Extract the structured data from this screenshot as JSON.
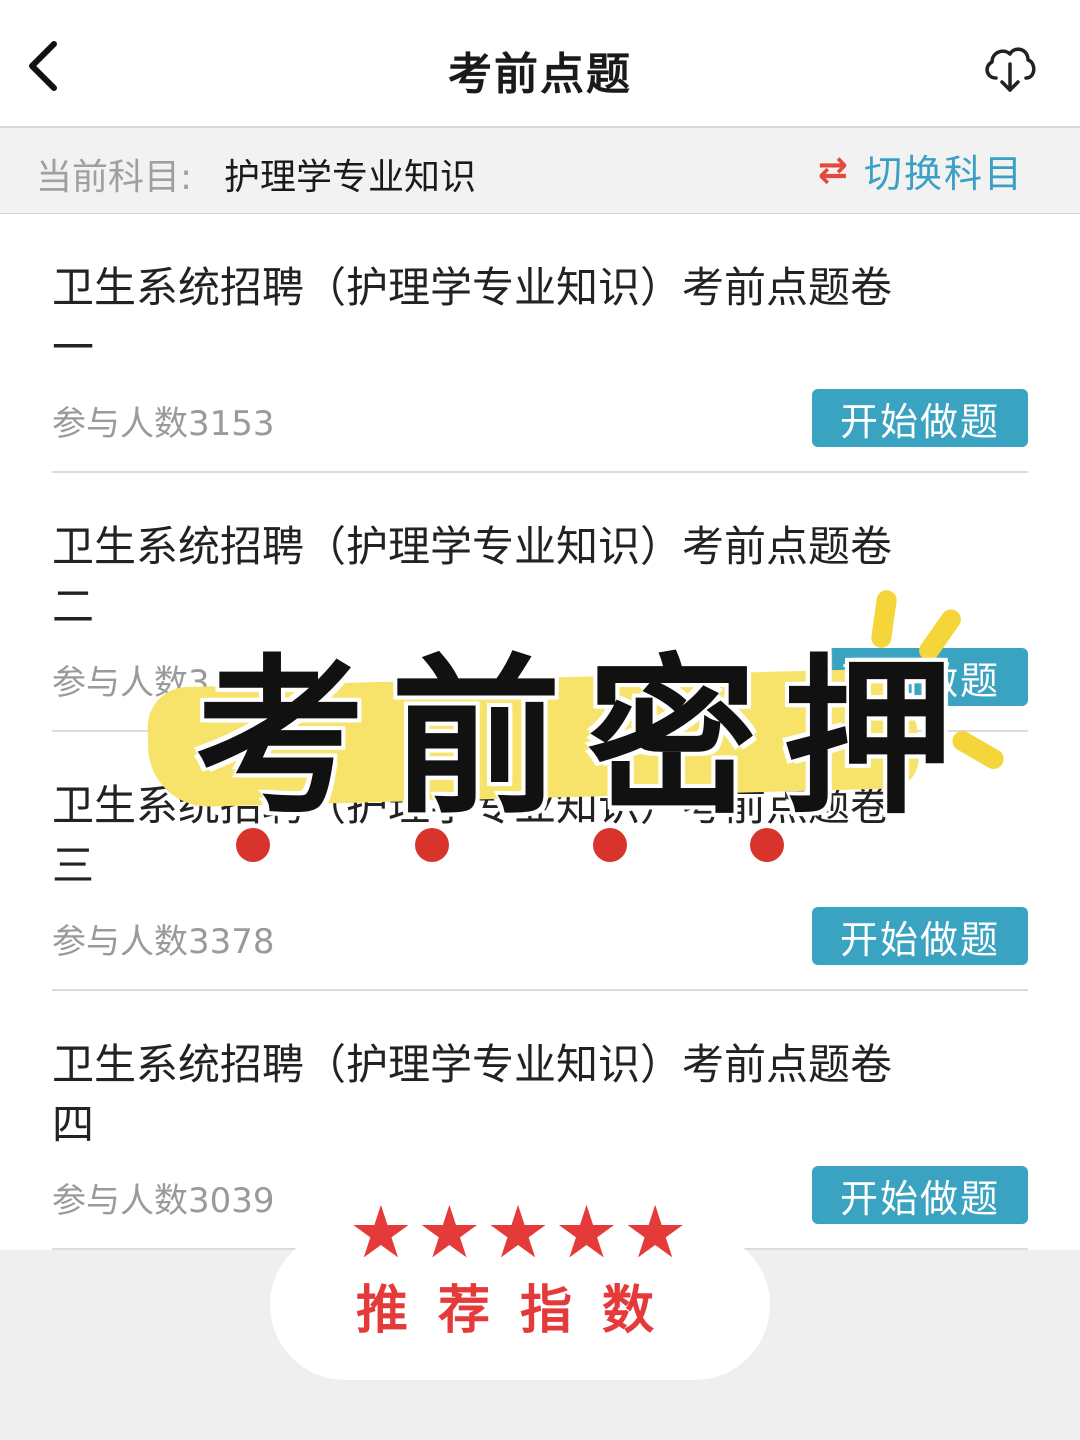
{
  "header": {
    "title": "考前点题",
    "back_icon": "chevron-left-icon",
    "download_icon": "cloud-download-icon"
  },
  "subject_bar": {
    "label": "当前科目:",
    "name": "护理学专业知识",
    "switch_icon": "⇄",
    "switch_label": "切换科目"
  },
  "exams": [
    {
      "title": "卫生系统招聘（护理学专业知识）考前点题卷一",
      "count_label": "参与人数3153",
      "button": "开始做题"
    },
    {
      "title": "卫生系统招聘（护理学专业知识）考前点题卷二",
      "count_label": "参与人数3",
      "button": "开始做题"
    },
    {
      "title": "卫生系统招聘（护理学专业知识）考前点题卷三",
      "count_label": "参与人数3378",
      "button": "开始做题"
    },
    {
      "title": "卫生系统招聘（护理学专业知识）考前点题卷四",
      "count_label": "参与人数3039",
      "button": "开始做题"
    }
  ],
  "overlay": {
    "headline": "考前密押",
    "stars": "★★★★★",
    "recommend_text": "推荐指数"
  },
  "colors": {
    "accent": "#3ba3c2",
    "switch_icon": "#e24a3b",
    "highlight": "#f7e36a",
    "star": "#e53a3a"
  }
}
